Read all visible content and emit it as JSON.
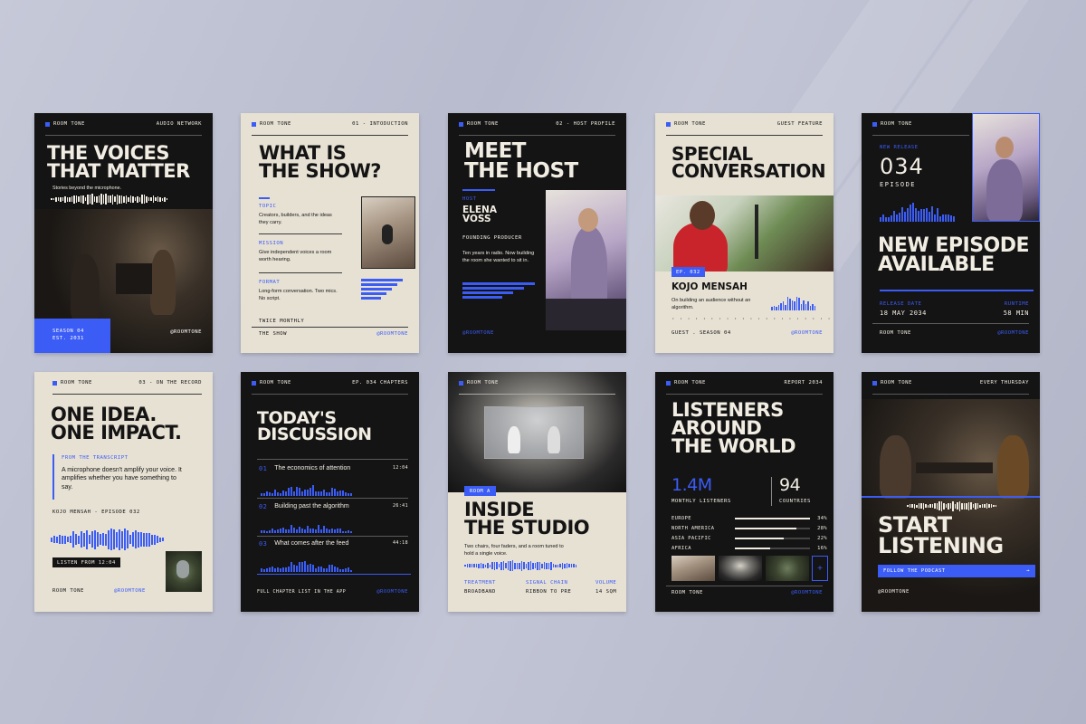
{
  "brand": {
    "name": "ROOM TONE",
    "handle": "@ROOMTONE",
    "accent": "#3b5cf5",
    "dark": "#141414",
    "light": "#e7e1d4"
  },
  "c1": {
    "tag": "AUDIO NETWORK",
    "title": [
      "THE VOICES",
      "THAT MATTER"
    ],
    "sub": "Stories beyond the microphone.",
    "season": "SEASON 04",
    "est": "EST. 2031"
  },
  "c2": {
    "tag": "01 - INTODUCTION",
    "title": [
      "WHAT IS",
      "THE SHOW?"
    ],
    "topic_h": "TOPIC",
    "topic": "Creators, builders, and the ideas they carry.",
    "mission_h": "MISSION",
    "mission": "Give independent voices a room worth hearing.",
    "format_h": "FORMAT",
    "format": "Long-form conversation. Two mics. No script.",
    "freq": "TWICE MONTHLY",
    "foot": "THE SHOW"
  },
  "c3": {
    "tag": "02 - HOST PROFILE",
    "title": [
      "MEET",
      "THE HOST"
    ],
    "host_h": "HOST",
    "host": [
      "ELENA",
      "VOSS"
    ],
    "role": "FOUNDING PRODUCER",
    "bio": "Ten years in radio. Now building the room she wanted to sit in."
  },
  "c4": {
    "tag": "GUEST FEATURE",
    "title": [
      "SPECIAL",
      "CONVERSATION"
    ],
    "ep": "EP. 032",
    "guest": "KOJO MENSAH",
    "desc": "On building an audience without an algorithm.",
    "foot": "GUEST . SEASON 04"
  },
  "c5": {
    "tag": "NEW RELEASE",
    "num": "034",
    "ep": "EPISODE",
    "title": [
      "NEW EPISODE",
      "AVAILABLE"
    ],
    "rd_h": "RELEASE DATE",
    "rd": "18 MAY 2034",
    "rt_h": "RUNTIME",
    "rt": "58 MIN",
    "foot": "ROOM TONE"
  },
  "c6": {
    "tag": "03 - ON THE RECORD",
    "title": [
      "ONE IDEA.",
      "ONE IMPACT."
    ],
    "from": "FROM THE TRANSCRIPT",
    "quote": "A microphone doesn't amplify your voice. It amplifies whether you have something to say.",
    "cite": "KOJO MENSAH - EPISODE 032",
    "listen": "LISTEN FROM 12:04",
    "foot": "ROOM TONE"
  },
  "c7": {
    "tag": "EP. 034 CHAPTERS",
    "title": [
      "TODAY'S",
      "DISCUSSION"
    ],
    "chapters": [
      {
        "n": "01",
        "t": "The economics of attention",
        "time": "12:04"
      },
      {
        "n": "02",
        "t": "Building past the algorithm",
        "time": "26:41"
      },
      {
        "n": "03",
        "t": "What comes after the feed",
        "time": "44:18"
      }
    ],
    "foot": "FULL CHAPTER LIST IN THE APP"
  },
  "c8": {
    "room": "ROOM A",
    "title": [
      "INSIDE",
      "THE STUDIO"
    ],
    "desc": "Two chairs, four faders, and a room tuned to hold a single voice.",
    "treat_h": "TREATMENT",
    "treat": "BROADBAND",
    "chain_h": "SIGNAL CHAIN",
    "chain": "RIBBON TO PRE",
    "vol_h": "VOLUME",
    "vol": "14 SQM"
  },
  "c9": {
    "tag": "REPORT 2034",
    "title": [
      "LISTENERS",
      "AROUND",
      "THE WORLD"
    ],
    "listeners": "1.4M",
    "listeners_l": "MONTHLY LISTENERS",
    "countries": "94",
    "countries_l": "COUNTRIES",
    "regions": [
      {
        "name": "EUROPE",
        "pct": "34%",
        "v": 0.34
      },
      {
        "name": "NORTH AMERICA",
        "pct": "28%",
        "v": 0.28
      },
      {
        "name": "ASIA PACIFIC",
        "pct": "22%",
        "v": 0.22
      },
      {
        "name": "AFRICA",
        "pct": "16%",
        "v": 0.16
      }
    ],
    "plus": "+",
    "foot": "ROOM TONE"
  },
  "c10": {
    "tag": "EVERY THURSDAY",
    "title": [
      "START",
      "LISTENING"
    ],
    "cta": "FOLLOW THE PODCAST",
    "arrow": "→"
  }
}
